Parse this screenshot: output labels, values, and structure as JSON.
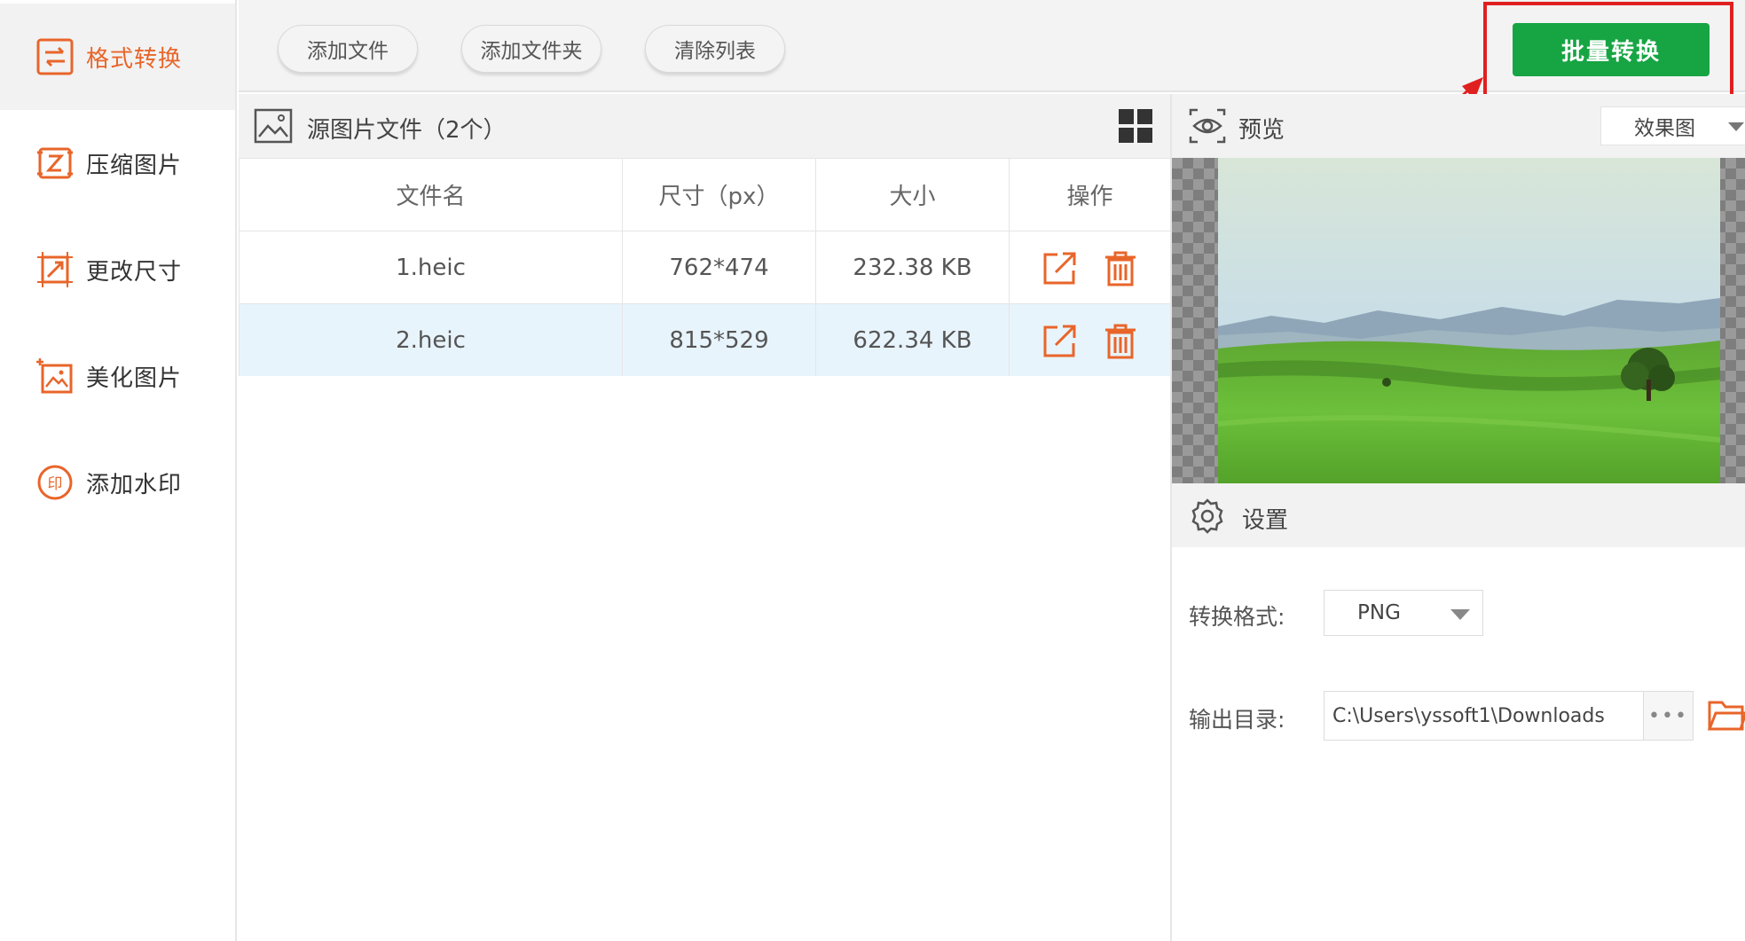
{
  "sidebar": {
    "items": [
      {
        "label": "格式转换",
        "icon": "format-convert-icon",
        "active": true
      },
      {
        "label": "压缩图片",
        "icon": "compress-icon",
        "active": false
      },
      {
        "label": "更改尺寸",
        "icon": "resize-icon",
        "active": false
      },
      {
        "label": "美化图片",
        "icon": "beautify-icon",
        "active": false
      },
      {
        "label": "添加水印",
        "icon": "watermark-icon",
        "active": false
      }
    ]
  },
  "toolbar": {
    "add_file_label": "添加文件",
    "add_folder_label": "添加文件夹",
    "clear_list_label": "清除列表",
    "batch_convert_label": "批量转换"
  },
  "source_panel": {
    "title": "源图片文件（2个）",
    "columns": [
      "文件名",
      "尺寸（px）",
      "大小",
      "操作"
    ],
    "rows": [
      {
        "name": "1.heic",
        "dimensions": "762*474",
        "size": "232.38 KB"
      },
      {
        "name": "2.heic",
        "dimensions": "815*529",
        "size": "622.34 KB"
      }
    ],
    "selected_row": 1
  },
  "preview": {
    "title": "预览",
    "mode_value": "效果图"
  },
  "settings": {
    "title": "设置",
    "format_label": "转换格式:",
    "format_value": "PNG",
    "output_label": "输出目录:",
    "output_value": "C:\\Users\\yssoft1\\Downloads",
    "browse_label": "•••"
  },
  "colors": {
    "accent": "#e8652a",
    "primary_button": "#17a543",
    "highlight": "#e02020",
    "selected_row": "#e8f4fc"
  }
}
